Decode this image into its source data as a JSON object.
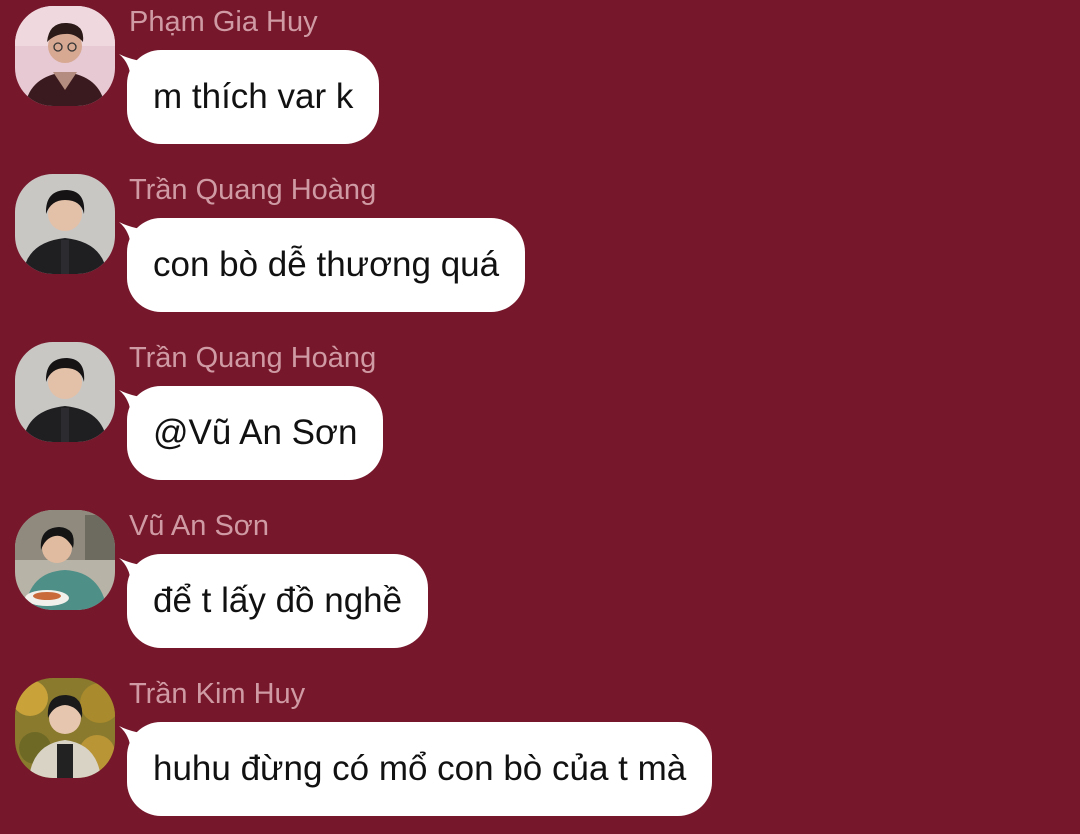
{
  "messages": [
    {
      "sender": "Phạm Gia Huy",
      "text": "m thích var k",
      "avatar": "avatar-pink-portrait"
    },
    {
      "sender": "Trần Quang Hoàng",
      "text": "con bò dễ thương quá",
      "avatar": "avatar-black-jacket"
    },
    {
      "sender": "Trần Quang Hoàng",
      "text": "@Vũ An Sơn",
      "avatar": "avatar-black-jacket"
    },
    {
      "sender": "Vũ An Sơn",
      "text": "để t lấy đồ nghề",
      "avatar": "avatar-eating-noodles"
    },
    {
      "sender": "Trần Kim Huy",
      "text": "huhu đừng có mổ con bò của t mà",
      "avatar": "avatar-autumn-leaves"
    }
  ],
  "colors": {
    "background": "#76172b",
    "bubble": "#ffffff",
    "sender_name": "#cf9aa3",
    "message_text": "#111111"
  }
}
